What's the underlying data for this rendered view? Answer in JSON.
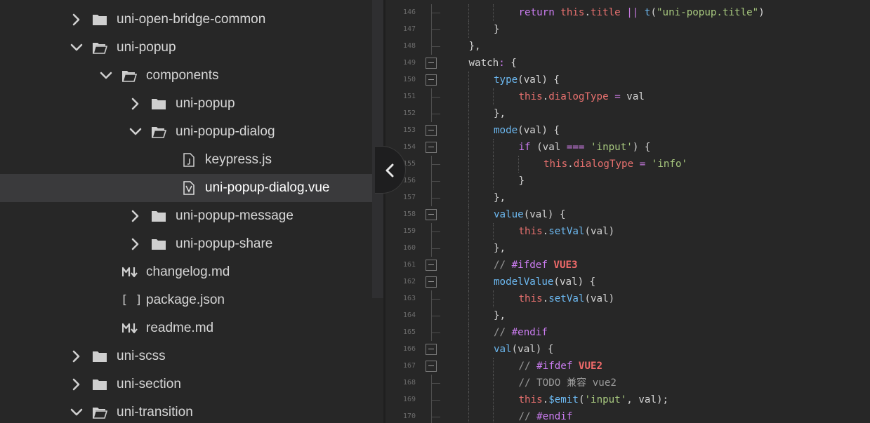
{
  "file_tree": {
    "items": [
      {
        "label": "uni-open-bridge-common",
        "type": "folder",
        "expanded": false,
        "depth": 0
      },
      {
        "label": "uni-popup",
        "type": "folder",
        "expanded": true,
        "depth": 0
      },
      {
        "label": "components",
        "type": "folder",
        "expanded": true,
        "depth": 1
      },
      {
        "label": "uni-popup",
        "type": "folder",
        "expanded": false,
        "depth": 2
      },
      {
        "label": "uni-popup-dialog",
        "type": "folder",
        "expanded": true,
        "depth": 2
      },
      {
        "label": "keypress.js",
        "type": "js-file",
        "depth": 3
      },
      {
        "label": "uni-popup-dialog.vue",
        "type": "vue-file",
        "depth": 3,
        "selected": true
      },
      {
        "label": "uni-popup-message",
        "type": "folder",
        "expanded": false,
        "depth": 2
      },
      {
        "label": "uni-popup-share",
        "type": "folder",
        "expanded": false,
        "depth": 2
      },
      {
        "label": "changelog.md",
        "type": "md-file",
        "depth": 1
      },
      {
        "label": "package.json",
        "type": "json-file",
        "depth": 1
      },
      {
        "label": "readme.md",
        "type": "md-file",
        "depth": 1
      },
      {
        "label": "uni-scss",
        "type": "folder",
        "expanded": false,
        "depth": 0
      },
      {
        "label": "uni-section",
        "type": "folder",
        "expanded": false,
        "depth": 0
      },
      {
        "label": "uni-transition",
        "type": "folder",
        "expanded": true,
        "depth": 0
      }
    ]
  },
  "icons": {
    "md_glyph": "M↓",
    "json_glyph": "[ ]",
    "collapse": "chevron-left-icon"
  },
  "colors": {
    "background": "#272727",
    "selected_row": "#3a3a3c",
    "keyword": "#cc7df2",
    "this_property": "#e8716f",
    "function": "#6cb8f0",
    "string": "#a8c97f",
    "comment": "#9a9a9a"
  },
  "editor": {
    "lines": [
      {
        "n": "146",
        "fold": "line",
        "guides": 3,
        "tokens": [
          [
            "kw",
            "return "
          ],
          [
            "th",
            "this"
          ],
          [
            "pl",
            "."
          ],
          [
            "pr",
            "title"
          ],
          [
            "pl",
            " "
          ],
          [
            "op",
            "||"
          ],
          [
            "pl",
            " "
          ],
          [
            "fn",
            "t"
          ],
          [
            "pl",
            "("
          ],
          [
            "st",
            "\"uni-popup.title\""
          ],
          [
            "pl",
            ")"
          ]
        ]
      },
      {
        "n": "147",
        "fold": "end",
        "guides": 2,
        "tokens": [
          [
            "pl",
            "}"
          ]
        ]
      },
      {
        "n": "148",
        "fold": "end",
        "guides": 1,
        "tokens": [
          [
            "pl",
            "},"
          ]
        ]
      },
      {
        "n": "149",
        "fold": "box",
        "guides": 1,
        "tokens": [
          [
            "pl",
            "watch"
          ],
          [
            "kw",
            ":"
          ],
          [
            "pl",
            " {"
          ]
        ]
      },
      {
        "n": "150",
        "fold": "box",
        "guides": 2,
        "tokens": [
          [
            "fn",
            "type"
          ],
          [
            "pl",
            "(val) {"
          ]
        ]
      },
      {
        "n": "151",
        "fold": "line",
        "guides": 3,
        "tokens": [
          [
            "th",
            "this"
          ],
          [
            "pl",
            "."
          ],
          [
            "pr",
            "dialogType"
          ],
          [
            "pl",
            " "
          ],
          [
            "op",
            "="
          ],
          [
            "pl",
            " val"
          ]
        ]
      },
      {
        "n": "152",
        "fold": "end",
        "guides": 2,
        "tokens": [
          [
            "pl",
            "},"
          ]
        ]
      },
      {
        "n": "153",
        "fold": "box",
        "guides": 2,
        "tokens": [
          [
            "fn",
            "mode"
          ],
          [
            "pl",
            "(val) {"
          ]
        ]
      },
      {
        "n": "154",
        "fold": "box",
        "guides": 3,
        "tokens": [
          [
            "kw",
            "if"
          ],
          [
            "pl",
            " (val "
          ],
          [
            "op",
            "==="
          ],
          [
            "pl",
            " "
          ],
          [
            "st",
            "'input'"
          ],
          [
            "pl",
            ") {"
          ]
        ]
      },
      {
        "n": "155",
        "fold": "line",
        "guides": 4,
        "tokens": [
          [
            "th",
            "this"
          ],
          [
            "pl",
            "."
          ],
          [
            "pr",
            "dialogType"
          ],
          [
            "pl",
            " "
          ],
          [
            "op",
            "="
          ],
          [
            "pl",
            " "
          ],
          [
            "st",
            "'info'"
          ]
        ]
      },
      {
        "n": "156",
        "fold": "end",
        "guides": 3,
        "tokens": [
          [
            "pl",
            "}"
          ]
        ]
      },
      {
        "n": "157",
        "fold": "end",
        "guides": 2,
        "tokens": [
          [
            "pl",
            "},"
          ]
        ]
      },
      {
        "n": "158",
        "fold": "box",
        "guides": 2,
        "tokens": [
          [
            "fn",
            "value"
          ],
          [
            "pl",
            "(val) {"
          ]
        ]
      },
      {
        "n": "159",
        "fold": "line",
        "guides": 3,
        "tokens": [
          [
            "th",
            "this"
          ],
          [
            "pl",
            "."
          ],
          [
            "fn",
            "setVal"
          ],
          [
            "pl",
            "(val)"
          ]
        ]
      },
      {
        "n": "160",
        "fold": "end",
        "guides": 2,
        "tokens": [
          [
            "pl",
            "},"
          ]
        ]
      },
      {
        "n": "161",
        "fold": "box",
        "guides": 2,
        "tokens": [
          [
            "cm",
            "// "
          ],
          [
            "cmk",
            "#ifdef"
          ],
          [
            "cm",
            " "
          ],
          [
            "cmb",
            "VUE3"
          ]
        ]
      },
      {
        "n": "162",
        "fold": "box",
        "guides": 2,
        "tokens": [
          [
            "fn",
            "modelValue"
          ],
          [
            "pl",
            "(val) {"
          ]
        ]
      },
      {
        "n": "163",
        "fold": "line",
        "guides": 3,
        "tokens": [
          [
            "th",
            "this"
          ],
          [
            "pl",
            "."
          ],
          [
            "fn",
            "setVal"
          ],
          [
            "pl",
            "(val)"
          ]
        ]
      },
      {
        "n": "164",
        "fold": "end",
        "guides": 2,
        "tokens": [
          [
            "pl",
            "},"
          ]
        ]
      },
      {
        "n": "165",
        "fold": "end",
        "guides": 2,
        "tokens": [
          [
            "cm",
            "// "
          ],
          [
            "cmk",
            "#endif"
          ]
        ]
      },
      {
        "n": "166",
        "fold": "box",
        "guides": 2,
        "tokens": [
          [
            "fn",
            "val"
          ],
          [
            "pl",
            "(val) {"
          ]
        ]
      },
      {
        "n": "167",
        "fold": "box",
        "guides": 3,
        "tokens": [
          [
            "cm",
            "// "
          ],
          [
            "cmk",
            "#ifdef"
          ],
          [
            "cm",
            " "
          ],
          [
            "cmb",
            "VUE2"
          ]
        ]
      },
      {
        "n": "168",
        "fold": "line",
        "guides": 3,
        "tokens": [
          [
            "cm",
            "// TODO 兼容 vue2"
          ]
        ]
      },
      {
        "n": "169",
        "fold": "line",
        "guides": 3,
        "tokens": [
          [
            "th",
            "this"
          ],
          [
            "pl",
            "."
          ],
          [
            "fn",
            "$emit"
          ],
          [
            "pl",
            "("
          ],
          [
            "st",
            "'input'"
          ],
          [
            "pl",
            ", val);"
          ]
        ]
      },
      {
        "n": "170",
        "fold": "end",
        "guides": 3,
        "tokens": [
          [
            "cm",
            "// "
          ],
          [
            "cmk",
            "#endif"
          ]
        ]
      }
    ]
  }
}
